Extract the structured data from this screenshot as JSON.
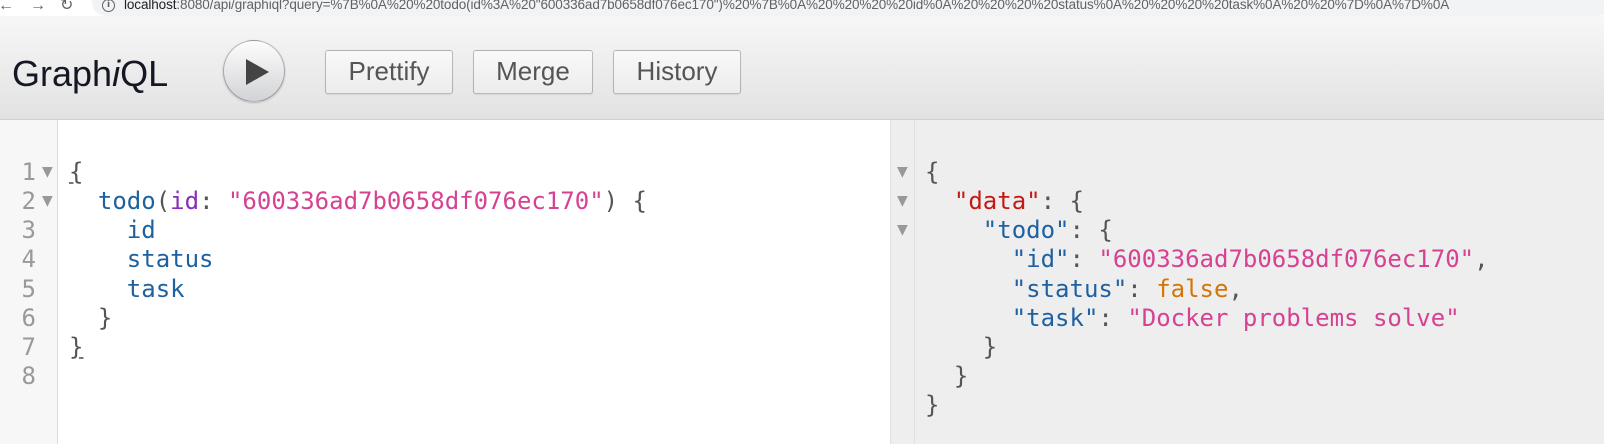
{
  "browser": {
    "url_host": "localhost",
    "url_rest": ":8080/api/graphiql?query=%7B%0A%20%20todo(id%3A%20\"600336ad7b0658df076ec170\")%20%7B%0A%20%20%20%20id%0A%20%20%20%20status%0A%20%20%20%20task%0A%20%20%7D%0A%7D%0A"
  },
  "toolbar": {
    "title_start": "Graph",
    "title_italic": "i",
    "title_end": "QL",
    "prettify_label": "Prettify",
    "merge_label": "Merge",
    "history_label": "History"
  },
  "query": {
    "line_numbers": [
      "1",
      "2",
      "3",
      "4",
      "5",
      "6",
      "7",
      "8"
    ],
    "todo_field": "todo",
    "arg_name": "id",
    "arg_value": "\"600336ad7b0658df076ec170\"",
    "fields": [
      "id",
      "status",
      "task"
    ]
  },
  "result": {
    "data_key": "\"data\"",
    "todo_key": "\"todo\"",
    "id_key": "\"id\"",
    "id_value": "\"600336ad7b0658df076ec170\"",
    "status_key": "\"status\"",
    "status_value": "false",
    "task_key": "\"task\"",
    "task_value": "\"Docker problems solve\""
  },
  "colors": {
    "field": "#1f61a0",
    "argument": "#8b2bb9",
    "string": "#d64292",
    "data_key": "#c41a16",
    "boolean": "#d47509"
  }
}
